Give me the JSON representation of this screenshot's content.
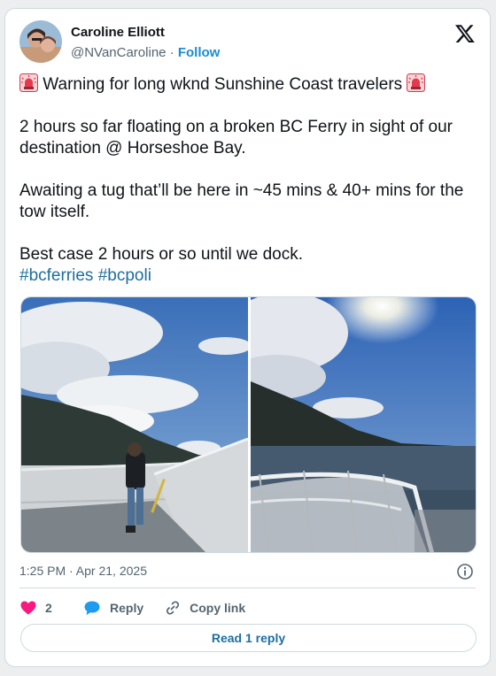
{
  "author": {
    "name": "Caroline Elliott",
    "handle": "@NVanCaroline",
    "separator": "·",
    "follow_label": "Follow"
  },
  "tweet": {
    "line1_text": "Warning for long wknd Sunshine Coast travelers",
    "line2": "2 hours so far floating on a broken BC Ferry in sight of our destination @ Horseshoe Bay.",
    "line3": "Awaiting a tug that’ll be here in ~45 mins & 40+ mins for the tow itself.",
    "line4": "Best case 2 hours or so until we dock.",
    "hashtags": [
      "#bcferries",
      "#bcpoli"
    ]
  },
  "timestamp": "1:25 PM · Apr 21, 2025",
  "actions": {
    "like_count": "2",
    "reply_label": "Reply",
    "copy_label": "Copy link"
  },
  "read_reply_label": "Read 1 reply",
  "colors": {
    "accent": "#1d8bd0",
    "hashtag": "#1d6e9e",
    "like": "#f91880",
    "reply": "#1d9bf0"
  },
  "icons": [
    "x-logo-icon",
    "siren-emoji-icon",
    "heart-icon",
    "speech-bubble-icon",
    "link-icon",
    "info-icon"
  ]
}
